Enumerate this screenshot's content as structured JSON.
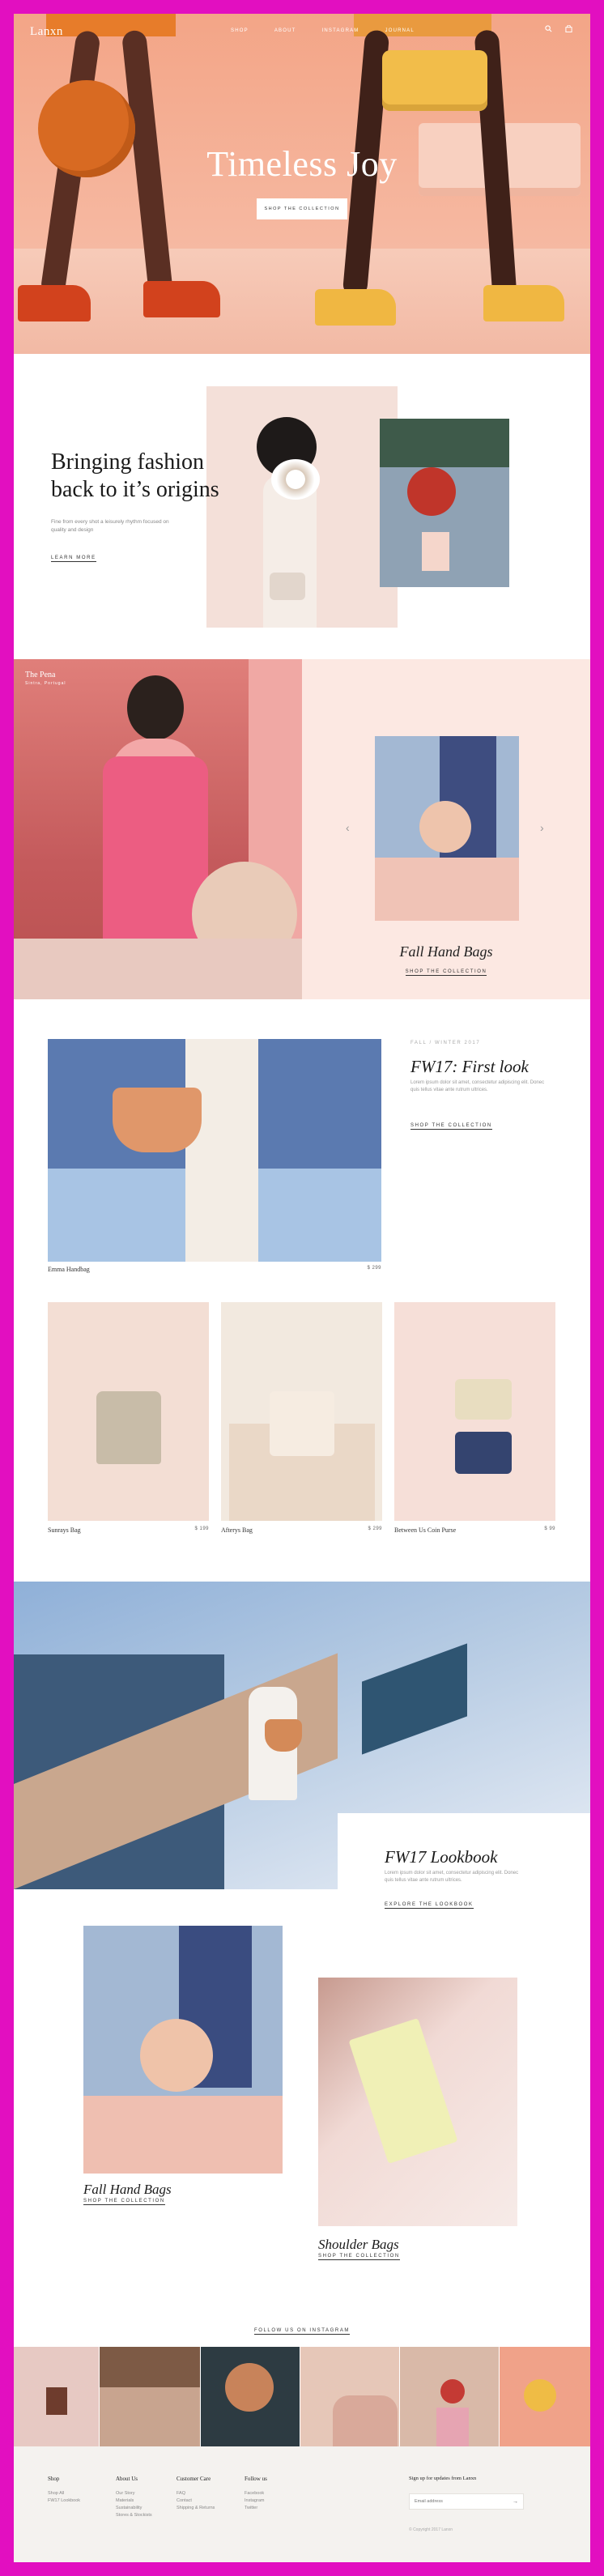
{
  "brand": {
    "logo": "Lanxn"
  },
  "nav": {
    "items": [
      "Shop",
      "About",
      "Instagram",
      "Journal"
    ]
  },
  "header_icons": [
    "search-icon",
    "bag-icon"
  ],
  "hero": {
    "title": "Timeless Joy",
    "button": "Shop the collection"
  },
  "intro": {
    "title_line1": "Bringing fashion",
    "title_line2": "back to it’s origins",
    "body": "Fine from every shot a leisurely rhythm focused on quality and design",
    "link": "Learn more"
  },
  "pena": {
    "title": "The Pena",
    "subtitle": "Sintra, Portugal"
  },
  "slider": {
    "title": "Fall Hand Bags",
    "link": "Shop the collection",
    "prev": "‹",
    "next": "›"
  },
  "first_look": {
    "kicker": "Fall / Winter 2017",
    "title": "FW17: First look",
    "body": "Lorem ipsum dolor sit amet, consectetur adipiscing elit. Donec quis tellus vitae ante rutrum ultrices.",
    "link": "Shop the collection",
    "product": {
      "name": "Emma Handbag",
      "price": "$ 299"
    }
  },
  "products": [
    {
      "name": "Sunrays Bag",
      "price": "$ 199"
    },
    {
      "name": "Afterys Bag",
      "price": "$ 299"
    },
    {
      "name": "Between Us Coin Purse",
      "price": "$ 99"
    }
  ],
  "lookbook": {
    "title": "FW17 Lookbook",
    "body": "Lorem ipsum dolor sit amet, consectetur adipiscing elit. Donec quis tellus vitae ante rutrum ultrices.",
    "link": "Explore the lookbook"
  },
  "categories": [
    {
      "title": "Fall Hand Bags",
      "link": "Shop the collection"
    },
    {
      "title": "Shoulder Bags",
      "link": "Shop the collection"
    }
  ],
  "instagram": {
    "label": "Follow us on Instagram"
  },
  "footer": {
    "columns": [
      {
        "title": "Shop",
        "items": [
          "Shop All",
          "FW17 Lookbook"
        ]
      },
      {
        "title": "About Us",
        "items": [
          "Our Story",
          "Materials",
          "Sustainability",
          "Stores & Stockists"
        ]
      },
      {
        "title": "Customer Care",
        "items": [
          "FAQ",
          "Contact",
          "Shipping & Returns"
        ]
      },
      {
        "title": "Follow us",
        "items": [
          "Facebook",
          "Instagram",
          "Twitter"
        ]
      }
    ],
    "newsletter": {
      "title": "Sign up for updates from Lanxn",
      "placeholder": "Email address",
      "arrow": "→"
    },
    "copyright": "© Copyright 2017 Lanxn"
  },
  "colors": {
    "frame": "#e20fc0",
    "hero": "#f4a98a",
    "pink_panel": "#fce8e2",
    "sky": "#a9c4e4",
    "footer": "#f4f2ef"
  }
}
